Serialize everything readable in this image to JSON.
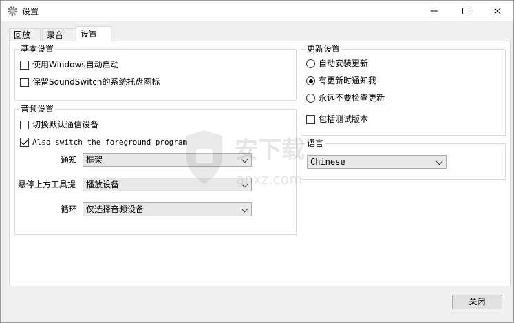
{
  "window": {
    "title": "设置",
    "minimize_glyph": "—",
    "maximize_glyph": "☐",
    "close_glyph": "✕"
  },
  "tabs": [
    {
      "label": "回放",
      "active": false
    },
    {
      "label": "录音",
      "active": false
    },
    {
      "label": "设置",
      "active": true
    }
  ],
  "basic_settings": {
    "title": "基本设置",
    "options": [
      {
        "label": "使用Windows自动启动",
        "checked": false
      },
      {
        "label": "保留SoundSwitch的系统托盘图标",
        "checked": false
      }
    ]
  },
  "audio_settings": {
    "title": "音频设置",
    "options": [
      {
        "label": "切换默认通信设备",
        "checked": false
      },
      {
        "label": "Also switch the foreground program",
        "checked": true
      }
    ],
    "notify": {
      "label": "通知",
      "value": "框架"
    },
    "tooltip": {
      "label": "悬停上方工具提",
      "value": "播放设备"
    },
    "cycle": {
      "label": "循环",
      "value": "仅选择音频设备"
    }
  },
  "update_settings": {
    "title": "更新设置",
    "radios": [
      {
        "label": "自动安装更新",
        "checked": false
      },
      {
        "label": "有更新时通知我",
        "checked": true
      },
      {
        "label": "永远不要检查更新",
        "checked": false
      }
    ],
    "beta": {
      "label": "包括测试版本",
      "checked": false
    }
  },
  "language": {
    "title": "语言",
    "value": "Chinese"
  },
  "footer": {
    "close_label": "关闭"
  },
  "watermark": {
    "text": "安下载",
    "domain": "anxz.com"
  }
}
